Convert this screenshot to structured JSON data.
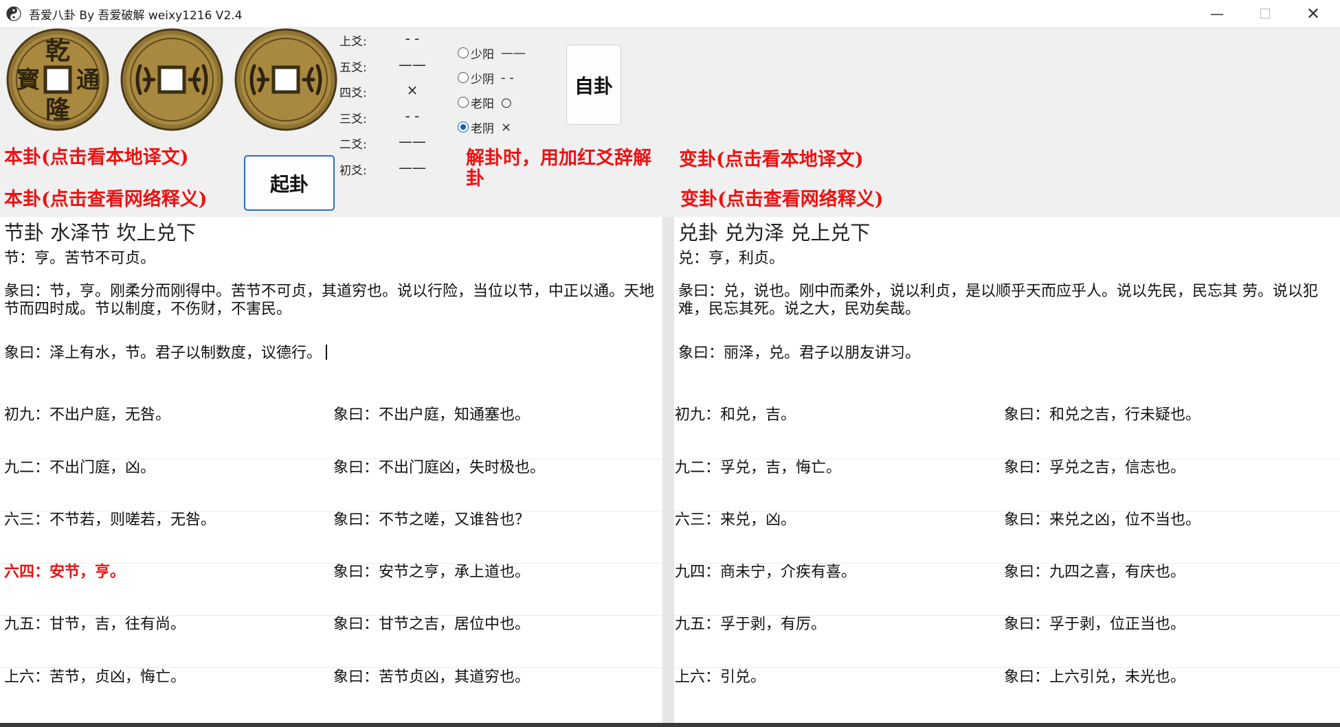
{
  "window": {
    "title": "吾爱八卦 By 吾爱破解 weixy1216 V2.4",
    "controls": {
      "minimize": "—",
      "maximize": "☐",
      "close": "✕"
    }
  },
  "coins": {
    "front_chars": {
      "top": "乾",
      "right": "通",
      "bottom": "隆",
      "left": "寳"
    },
    "colors": {
      "bronze": "#a8893f",
      "dark": "#4a3a1a"
    }
  },
  "yao": [
    {
      "label": "上爻:",
      "symbol": "- -"
    },
    {
      "label": "五爻:",
      "symbol": "——"
    },
    {
      "label": "四爻:",
      "symbol": "×"
    },
    {
      "label": "三爻:",
      "symbol": "- -"
    },
    {
      "label": "二爻:",
      "symbol": "——"
    },
    {
      "label": "初爻:",
      "symbol": "——"
    }
  ],
  "radios": [
    {
      "label": "少阳",
      "symbol": "——",
      "checked": false
    },
    {
      "label": "少阴",
      "symbol": "- -",
      "checked": false
    },
    {
      "label": "老阳",
      "symbol": "○",
      "checked": false
    },
    {
      "label": "老阴",
      "symbol": "×",
      "checked": true
    }
  ],
  "buttons": {
    "qigua": "起卦",
    "zigua": "自卦"
  },
  "links": {
    "ben_local": "本卦(点击看本地译文)",
    "ben_net": "本卦(点击查看网络释义)",
    "bian_local": "变卦(点击看本地译文)",
    "bian_net": "变卦(点击查看网络释义)"
  },
  "hint": "解卦时，用加红爻辞解卦",
  "left_panel": {
    "heading": "节卦  水泽节  坎上兑下",
    "judgement": "节：亨。苦节不可贞。",
    "tuan": "彖曰：节，亨。刚柔分而刚得中。苦节不可贞，其道穷也。说以行险，当位以节，中正以通。天地节而四时成。节以制度，不伤财，不害民。",
    "xiang": "象曰：泽上有水，节。君子以制数度，议德行。",
    "lines": [
      {
        "text": "初九：不出户庭，无咎。",
        "xiang": "象曰：不出户庭，知通塞也。",
        "highlight": false
      },
      {
        "text": "九二：不出门庭，凶。",
        "xiang": "象曰：不出门庭凶，失时极也。",
        "highlight": false
      },
      {
        "text": "六三：不节若，则嗟若，无咎。",
        "xiang": "象曰：不节之嗟，又谁咎也？",
        "highlight": false
      },
      {
        "text": "六四：安节，亨。",
        "xiang": "象曰：安节之亨，承上道也。",
        "highlight": true
      },
      {
        "text": "九五：甘节，吉，往有尚。",
        "xiang": "象曰：甘节之吉，居位中也。",
        "highlight": false
      },
      {
        "text": "上六：苦节，贞凶，悔亡。",
        "xiang": "象曰：苦节贞凶，其道穷也。",
        "highlight": false
      }
    ]
  },
  "right_panel": {
    "heading": "兑卦  兑为泽  兑上兑下",
    "judgement": "兑：亨，利贞。",
    "tuan": "彖曰：兑，说也。刚中而柔外，说以利贞，是以顺乎天而应乎人。说以先民，民忘其 劳。说以犯难，民忘其死。说之大，民劝矣哉。",
    "xiang": "象曰：丽泽，兑。君子以朋友讲习。",
    "lines": [
      {
        "text": "初九：和兑，吉。",
        "xiang": "象曰：和兑之吉，行未疑也。",
        "highlight": false
      },
      {
        "text": "九二：孚兑，吉，悔亡。",
        "xiang": "象曰：孚兑之吉，信志也。",
        "highlight": false
      },
      {
        "text": "六三：来兑，凶。",
        "xiang": "象曰：来兑之凶，位不当也。",
        "highlight": false
      },
      {
        "text": "九四：商未宁，介疾有喜。",
        "xiang": "象曰：九四之喜，有庆也。",
        "highlight": false
      },
      {
        "text": "九五：孚于剥，有厉。",
        "xiang": "象曰：孚于剥，位正当也。",
        "highlight": false
      },
      {
        "text": "上六：引兑。",
        "xiang": "象曰：上六引兑，未光也。",
        "highlight": false
      }
    ]
  }
}
